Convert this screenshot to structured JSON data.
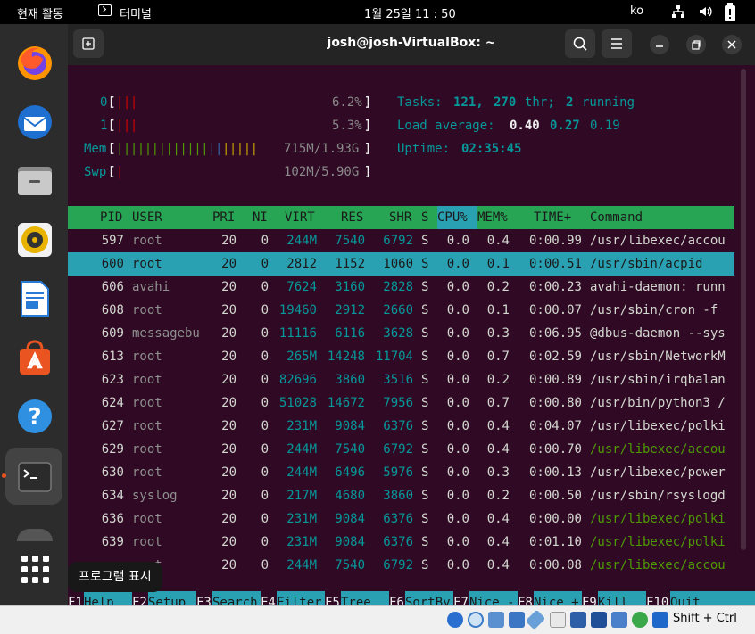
{
  "topbar": {
    "activities": "현재 활동",
    "app_name": "터미널",
    "clock": "1월 25일  11 : 50",
    "lang": "ko"
  },
  "dock": {
    "items": [
      {
        "name": "firefox-icon",
        "color": "#e66000"
      },
      {
        "name": "thunderbird-icon",
        "color": "#1f6fd0"
      },
      {
        "name": "files-icon",
        "color": "#9a9a9a"
      },
      {
        "name": "rhythmbox-icon",
        "color": "#e8b400"
      },
      {
        "name": "writer-icon",
        "color": "#2a7bd6"
      },
      {
        "name": "software-icon",
        "color": "#e95420"
      },
      {
        "name": "help-icon",
        "color": "#2f8fe0"
      },
      {
        "name": "terminal-icon",
        "color": "#3a3a3a"
      },
      {
        "name": "show-apps-icon",
        "color": "#ffffff"
      }
    ],
    "tooltip": "프로그램 표시"
  },
  "window": {
    "title": "josh@josh-VirtualBox: ~"
  },
  "htop": {
    "cpu0": {
      "label": "0",
      "bars": "|||",
      "pct": "6.2%"
    },
    "cpu1": {
      "label": "1",
      "bars": "|||",
      "pct": "5.3%"
    },
    "mem": {
      "label": "Mem",
      "bars": "||||||||||||||||||||",
      "value": "715M/1.93G"
    },
    "swp": {
      "label": "Swp",
      "bars": "|",
      "value": "102M/5.90G"
    },
    "tasks_label": "Tasks:",
    "tasks_value": "121,",
    "thr_value": "270",
    "thr_label": "thr;",
    "running_value": "2",
    "running_label": "running",
    "load_label": "Load average:",
    "load1": "0.40",
    "load5": "0.27",
    "load15": "0.19",
    "uptime_label": "Uptime:",
    "uptime_value": "02:35:45",
    "columns": [
      "PID",
      "USER",
      "PRI",
      "NI",
      "VIRT",
      "RES",
      "SHR",
      "S",
      "CPU%",
      "MEM%",
      "TIME+",
      "Command"
    ],
    "rows": [
      {
        "pid": "597",
        "user": "root",
        "pri": "20",
        "ni": "0",
        "virt": "244M",
        "res": "7540",
        "shr": "6792",
        "s": "S",
        "cpu": "0.0",
        "mem": "0.4",
        "time": "0:00.99",
        "cmd": "/usr/libexec/accou"
      },
      {
        "pid": "600",
        "user": "root",
        "pri": "20",
        "ni": "0",
        "virt": "2812",
        "res": "1152",
        "shr": "1060",
        "s": "S",
        "cpu": "0.0",
        "mem": "0.1",
        "time": "0:00.51",
        "cmd": "/usr/sbin/acpid"
      },
      {
        "pid": "606",
        "user": "avahi",
        "pri": "20",
        "ni": "0",
        "virt": "7624",
        "res": "3160",
        "shr": "2828",
        "s": "S",
        "cpu": "0.0",
        "mem": "0.2",
        "time": "0:00.23",
        "cmd": "avahi-daemon: runn"
      },
      {
        "pid": "608",
        "user": "root",
        "pri": "20",
        "ni": "0",
        "virt": "19460",
        "res": "2912",
        "shr": "2660",
        "s": "S",
        "cpu": "0.0",
        "mem": "0.1",
        "time": "0:00.07",
        "cmd": "/usr/sbin/cron -f"
      },
      {
        "pid": "609",
        "user": "messagebu",
        "pri": "20",
        "ni": "0",
        "virt": "11116",
        "res": "6116",
        "shr": "3628",
        "s": "S",
        "cpu": "0.0",
        "mem": "0.3",
        "time": "0:06.95",
        "cmd": "@dbus-daemon --sys"
      },
      {
        "pid": "613",
        "user": "root",
        "pri": "20",
        "ni": "0",
        "virt": "265M",
        "res": "14248",
        "shr": "11704",
        "s": "S",
        "cpu": "0.0",
        "mem": "0.7",
        "time": "0:02.59",
        "cmd": "/usr/sbin/NetworkM"
      },
      {
        "pid": "623",
        "user": "root",
        "pri": "20",
        "ni": "0",
        "virt": "82696",
        "res": "3860",
        "shr": "3516",
        "s": "S",
        "cpu": "0.0",
        "mem": "0.2",
        "time": "0:00.89",
        "cmd": "/usr/sbin/irqbalan"
      },
      {
        "pid": "624",
        "user": "root",
        "pri": "20",
        "ni": "0",
        "virt": "51028",
        "res": "14672",
        "shr": "7956",
        "s": "S",
        "cpu": "0.0",
        "mem": "0.7",
        "time": "0:00.80",
        "cmd": "/usr/bin/python3 /"
      },
      {
        "pid": "627",
        "user": "root",
        "pri": "20",
        "ni": "0",
        "virt": "231M",
        "res": "9084",
        "shr": "6376",
        "s": "S",
        "cpu": "0.0",
        "mem": "0.4",
        "time": "0:04.07",
        "cmd": "/usr/libexec/polki"
      },
      {
        "pid": "629",
        "user": "root",
        "pri": "20",
        "ni": "0",
        "virt": "244M",
        "res": "7540",
        "shr": "6792",
        "s": "S",
        "cpu": "0.0",
        "mem": "0.4",
        "time": "0:00.70",
        "cmd": "/usr/libexec/accou"
      },
      {
        "pid": "630",
        "user": "root",
        "pri": "20",
        "ni": "0",
        "virt": "244M",
        "res": "6496",
        "shr": "5976",
        "s": "S",
        "cpu": "0.0",
        "mem": "0.3",
        "time": "0:00.13",
        "cmd": "/usr/libexec/power"
      },
      {
        "pid": "634",
        "user": "syslog",
        "pri": "20",
        "ni": "0",
        "virt": "217M",
        "res": "4680",
        "shr": "3860",
        "s": "S",
        "cpu": "0.0",
        "mem": "0.2",
        "time": "0:00.50",
        "cmd": "/usr/sbin/rsyslogd"
      },
      {
        "pid": "636",
        "user": "root",
        "pri": "20",
        "ni": "0",
        "virt": "231M",
        "res": "9084",
        "shr": "6376",
        "s": "S",
        "cpu": "0.0",
        "mem": "0.4",
        "time": "0:00.00",
        "cmd": "/usr/libexec/polki"
      },
      {
        "pid": "639",
        "user": "root",
        "pri": "20",
        "ni": "0",
        "virt": "231M",
        "res": "9084",
        "shr": "6376",
        "s": "S",
        "cpu": "0.0",
        "mem": "0.4",
        "time": "0:01.10",
        "cmd": "/usr/libexec/polki"
      },
      {
        "pid": "",
        "user": "root",
        "pri": "20",
        "ni": "0",
        "virt": "244M",
        "res": "7540",
        "shr": "6792",
        "s": "S",
        "cpu": "0.0",
        "mem": "0.4",
        "time": "0:00.08",
        "cmd": "/usr/libexec/accou"
      }
    ],
    "fkeys": [
      {
        "key": "F1",
        "label": "Help"
      },
      {
        "key": "F2",
        "label": "Setup"
      },
      {
        "key": "F3",
        "label": "Search"
      },
      {
        "key": "F4",
        "label": "Filter"
      },
      {
        "key": "F5",
        "label": "Tree"
      },
      {
        "key": "F6",
        "label": "SortBy"
      },
      {
        "key": "F7",
        "label": "Nice -"
      },
      {
        "key": "F8",
        "label": "Nice +"
      },
      {
        "key": "F9",
        "label": "Kill"
      },
      {
        "key": "F10",
        "label": "Quit"
      }
    ]
  },
  "statusbar": {
    "host_key": "Shift + Ctrl"
  }
}
